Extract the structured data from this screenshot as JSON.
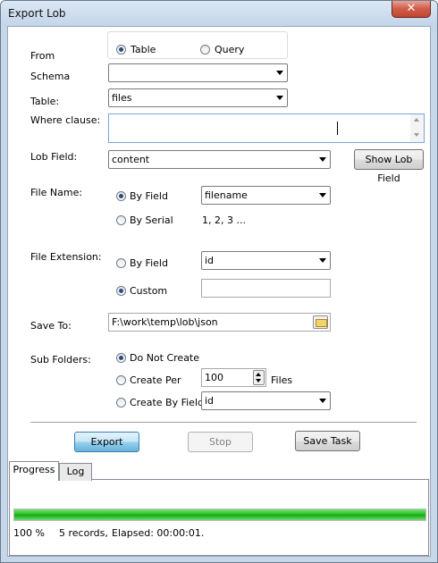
{
  "window": {
    "title": "Export Lob",
    "close_glyph": "✕"
  },
  "from": {
    "label": "From",
    "options": [
      "Table",
      "Query"
    ],
    "selected": "Table"
  },
  "schema": {
    "label": "Schema",
    "value": ""
  },
  "table": {
    "label": "Table:",
    "value": "files"
  },
  "where": {
    "label": "Where clause:",
    "value": ""
  },
  "lob_field": {
    "label": "Lob Field:",
    "value": "content",
    "button": "Show Lob Field"
  },
  "file_name": {
    "label": "File Name:",
    "by_field": "By Field",
    "by_field_value": "filename",
    "by_serial": "By Serial",
    "serial_example": "1, 2, 3 ...",
    "selected": "By Field"
  },
  "file_ext": {
    "label": "File Extension:",
    "by_field": "By Field",
    "by_field_value": "id",
    "custom": "Custom",
    "custom_value": "",
    "selected": "Custom"
  },
  "save_to": {
    "label": "Save To:",
    "value": "F:\\work\\temp\\lob\\json"
  },
  "sub_folders": {
    "label": "Sub Folders:",
    "do_not_create": "Do Not Create",
    "create_per": "Create Per",
    "create_per_value": "100",
    "files_label": "Files",
    "create_by_field": "Create By Field",
    "by_field_value": "id",
    "selected": "Do Not Create"
  },
  "actions": {
    "export": "Export",
    "stop": "Stop",
    "save_task": "Save Task"
  },
  "tabs": [
    {
      "label": "Progress"
    },
    {
      "label": "Log"
    }
  ],
  "progress": {
    "percent": 100,
    "percent_text": "100 %",
    "records": "5 records,",
    "elapsed": "Elapsed: 00:00:01."
  },
  "colors": {
    "progress_fill": "#23c023",
    "title_bar": "#c7d7ea",
    "close_button": "#c0442f",
    "default_button": "#68b3db"
  }
}
